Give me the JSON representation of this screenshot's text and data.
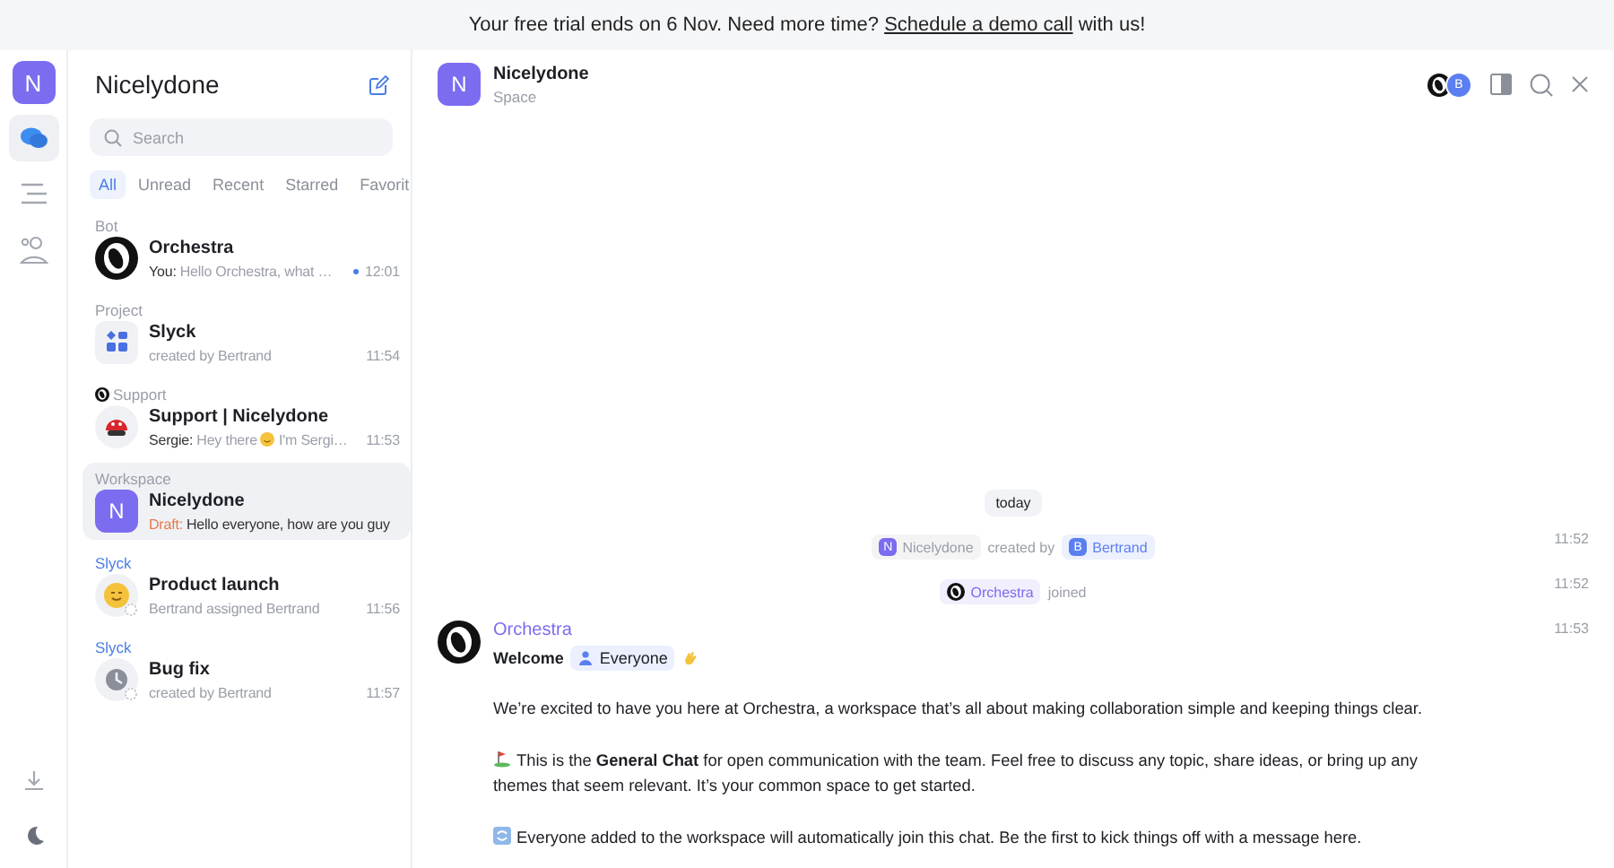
{
  "banner": {
    "text_before": "Your free trial ends on 6 Nov. Need more time?",
    "link": "Schedule a demo call",
    "text_after": "with us!"
  },
  "rail": {
    "workspace_letter": "N",
    "items": [
      {
        "kind": "chat",
        "selected": true
      },
      {
        "kind": "list",
        "selected": false
      },
      {
        "kind": "people",
        "selected": false
      }
    ],
    "bottom": [
      {
        "kind": "download"
      },
      {
        "kind": "moon"
      }
    ]
  },
  "sidebar": {
    "title": "Nicelydone",
    "search": {
      "placeholder": "Search"
    },
    "filters": [
      {
        "label": "All",
        "selected": true
      },
      {
        "label": "Unread",
        "selected": false
      },
      {
        "label": "Recent",
        "selected": false
      },
      {
        "label": "Starred",
        "selected": false
      },
      {
        "label": "Favorit",
        "selected": false
      }
    ],
    "chats": [
      {
        "group": "Bot",
        "group_linked": false,
        "group_logo": false,
        "kind": "orchestra",
        "title": "Orchestra",
        "prefix": "You:",
        "draft": false,
        "message": "Hello Orchestra, what …",
        "unread": true,
        "time": "12:01",
        "selected": false
      },
      {
        "group": "Project",
        "group_linked": false,
        "group_logo": false,
        "kind": "apps",
        "title": "Slyck",
        "message": "created by Bertrand",
        "unread": false,
        "time": "11:54",
        "selected": false
      },
      {
        "group": "Support",
        "group_linked": false,
        "group_logo": true,
        "kind": "mushroom",
        "title": "Support | Nicelydone",
        "prefix": "Sergie:",
        "draft": false,
        "message": "Hey there",
        "message_after": "I'm Sergi…",
        "unread": false,
        "time": "11:53",
        "selected": false
      },
      {
        "group": "Workspace",
        "group_linked": false,
        "group_logo": false,
        "kind": "letter",
        "letter": "N",
        "title": "Nicelydone",
        "prefix": "Draft:",
        "draft": true,
        "message": "Hello everyone, how are you guy",
        "unread": false,
        "selected": true
      },
      {
        "group": "Slyck",
        "group_linked": true,
        "group_logo": false,
        "kind": "smile",
        "title": "Product launch",
        "message": "Bertrand assigned Bertrand",
        "unread": false,
        "time": "11:56",
        "selected": false
      },
      {
        "group": "Slyck",
        "group_linked": true,
        "group_logo": false,
        "kind": "clock",
        "title": "Bug fix",
        "message": "created by Bertrand",
        "unread": false,
        "time": "11:57",
        "selected": false
      }
    ]
  },
  "header": {
    "letter": "N",
    "title": "Nicelydone",
    "subtitle": "Space",
    "member_letter": "B"
  },
  "timeline": {
    "date": "today",
    "events": [
      {
        "kind": "system",
        "parts": [
          {
            "kind": "chip",
            "letter": "N",
            "label": "Nicelydone",
            "color": "#9a9ea8"
          },
          {
            "kind": "text",
            "text": "created by"
          },
          {
            "kind": "chip",
            "letter": "B",
            "label": "Bertrand",
            "color": "#5b7ff0"
          }
        ],
        "time": "11:52"
      },
      {
        "kind": "system",
        "parts": [
          {
            "kind": "chip",
            "label": "Orchestra",
            "color": "#7b6cf0"
          },
          {
            "kind": "text",
            "text": "joined"
          }
        ],
        "time": "11:52"
      },
      {
        "kind": "message",
        "sender": "Orchestra",
        "time": "11:53",
        "greeting": "Welcome",
        "mention": "Everyone",
        "paragraphs": [
          {
            "kind": "plain",
            "text": "We’re excited to have you here at Orchestra, a workspace that’s all about making collaboration simple and keeping things clear."
          },
          {
            "kind": "flag",
            "text": "This is the **General Chat** for open communication with the team. Feel free to discuss any topic, share ideas, or bring up any themes that seem relevant. It’s your common space to get started."
          },
          {
            "kind": "arrows",
            "text": "Everyone added to the workspace will automatically join this chat. Be the first to kick things off with a message here."
          }
        ]
      }
    ]
  }
}
